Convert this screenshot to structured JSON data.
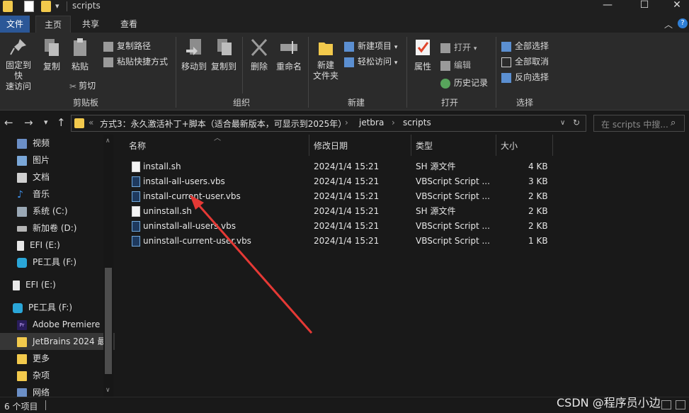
{
  "window": {
    "title": "scripts",
    "minimize": "—",
    "maximize": "☐",
    "close": "✕"
  },
  "ribbon_tabs": [
    "文件",
    "主页",
    "共享",
    "查看"
  ],
  "ribbon": {
    "clipboard": {
      "pin_label": "固定到快\n速访问",
      "copy_label": "复制",
      "paste_label": "粘贴",
      "copy_path": "复制路径",
      "paste_shortcut": "粘贴快捷方式",
      "cut": "剪切",
      "group_label": "剪贴板"
    },
    "organize": {
      "move_to": "移动到",
      "copy_to": "复制到",
      "delete": "删除",
      "rename": "重命名",
      "group_label": "组织"
    },
    "new": {
      "new_folder": "新建\n文件夹",
      "new_item": "新建项目",
      "easy_access": "轻松访问",
      "group_label": "新建"
    },
    "open": {
      "properties": "属性",
      "open": "打开",
      "edit": "编辑",
      "history": "历史记录",
      "group_label": "打开"
    },
    "select": {
      "select_all": "全部选择",
      "select_none": "全部取消",
      "invert": "反向选择",
      "group_label": "选择"
    }
  },
  "address": {
    "crumbs": [
      "方式3：永久激活补丁+脚本（适合最新版本，可显示到2025年）",
      "jetbra",
      "scripts"
    ],
    "search_placeholder": "在 scripts 中搜..."
  },
  "nav": {
    "items": [
      {
        "label": "视频",
        "icon": "video-folder-icon",
        "color": "#6b8fc7"
      },
      {
        "label": "图片",
        "icon": "pictures-folder-icon",
        "color": "#7aa7d8"
      },
      {
        "label": "文档",
        "icon": "documents-folder-icon",
        "color": "#d0d0d0"
      },
      {
        "label": "音乐",
        "icon": "music-folder-icon",
        "color": "#3c8ee8"
      },
      {
        "label": "系统 (C:)",
        "icon": "windows-drive-icon",
        "color": "#9aa8b5"
      },
      {
        "label": "新加卷 (D:)",
        "icon": "drive-icon",
        "color": "#b5b5b5"
      },
      {
        "label": "EFI (E:)",
        "icon": "drive-icon",
        "color": "#e8e8e8"
      },
      {
        "label": "PE工具 (F:)",
        "icon": "pe-drive-icon",
        "color": "#2aa6d8"
      },
      {
        "label": "EFI (E:)",
        "icon": "drive-icon",
        "color": "#e8e8e8"
      },
      {
        "label": "PE工具 (F:)",
        "icon": "pe-drive-icon",
        "color": "#2aa6d8"
      },
      {
        "label": "Adobe Premiere",
        "icon": "premiere-icon",
        "color": "#2a1d5c"
      },
      {
        "label": "JetBrains  2024 最",
        "icon": "folder-icon",
        "color": "#f2c94c"
      },
      {
        "label": "更多",
        "icon": "folder-icon",
        "color": "#f2c94c"
      },
      {
        "label": "杂项",
        "icon": "folder-icon",
        "color": "#f2c94c"
      },
      {
        "label": "网络",
        "icon": "network-icon",
        "color": "#6b8fc7"
      }
    ]
  },
  "file_list": {
    "columns": [
      "名称",
      "修改日期",
      "类型",
      "大小"
    ],
    "rows": [
      {
        "name": "install.sh",
        "modified": "2024/1/4 15:21",
        "type": "SH 源文件",
        "size": "4 KB",
        "icon": "sh-file-icon"
      },
      {
        "name": "install-all-users.vbs",
        "modified": "2024/1/4 15:21",
        "type": "VBScript Script ...",
        "size": "3 KB",
        "icon": "vbs-file-icon"
      },
      {
        "name": "install-current-user.vbs",
        "modified": "2024/1/4 15:21",
        "type": "VBScript Script ...",
        "size": "2 KB",
        "icon": "vbs-file-icon"
      },
      {
        "name": "uninstall.sh",
        "modified": "2024/1/4 15:21",
        "type": "SH 源文件",
        "size": "2 KB",
        "icon": "sh-file-icon"
      },
      {
        "name": "uninstall-all-users.vbs",
        "modified": "2024/1/4 15:21",
        "type": "VBScript Script ...",
        "size": "2 KB",
        "icon": "vbs-file-icon"
      },
      {
        "name": "uninstall-current-user.vbs",
        "modified": "2024/1/4 15:21",
        "type": "VBScript Script ...",
        "size": "1 KB",
        "icon": "vbs-file-icon"
      }
    ]
  },
  "status": {
    "count": "6 个项目"
  },
  "watermark": "CSDN @程序员小边",
  "colors": {
    "accent": "#2b5797",
    "annotation_arrow": "#e53935"
  }
}
